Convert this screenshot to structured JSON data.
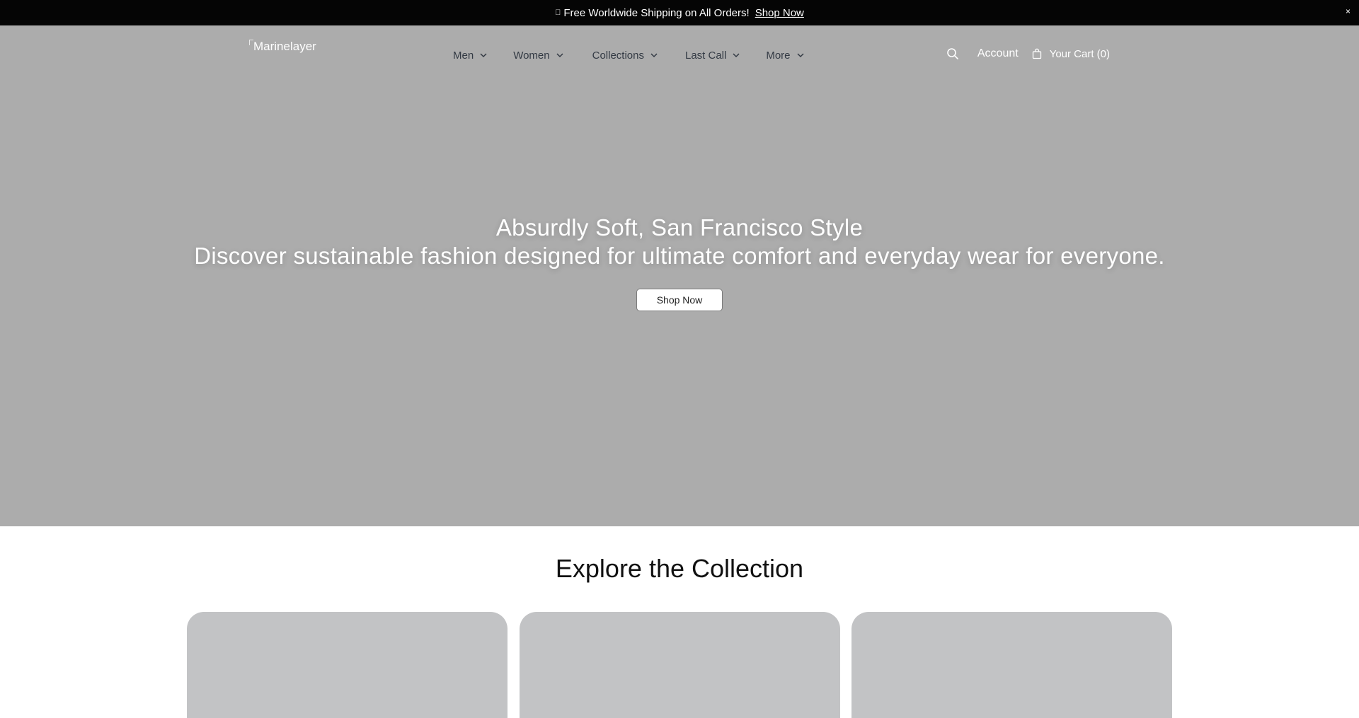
{
  "announcement": {
    "glyph": "",
    "text": "Free Worldwide Shipping on All Orders!",
    "link_label": "Shop Now",
    "close_glyph": "×"
  },
  "header": {
    "logo_alt": "Marinelayer",
    "nav": [
      {
        "label": "Men"
      },
      {
        "label": "Women"
      },
      {
        "label": "Collections"
      },
      {
        "label": "Last Call"
      },
      {
        "label": "More"
      }
    ],
    "account_label": "Account",
    "cart_label": "Your Cart (0)"
  },
  "hero": {
    "title": "Absurdly Soft, San Francisco Style",
    "subtitle": "Discover sustainable fashion designed for ultimate comfort and everyday wear for everyone.",
    "cta_label": "Shop Now"
  },
  "explore": {
    "title": "Explore the Collection"
  },
  "colors": {
    "announcement_bg": "#050505",
    "hero_bg": "#acacac",
    "card_bg": "#c2c3c5",
    "nav_text": "#333a44"
  },
  "icons": {
    "search": "search-icon",
    "cart": "bag-icon",
    "chevron": "chevron-down-icon"
  }
}
